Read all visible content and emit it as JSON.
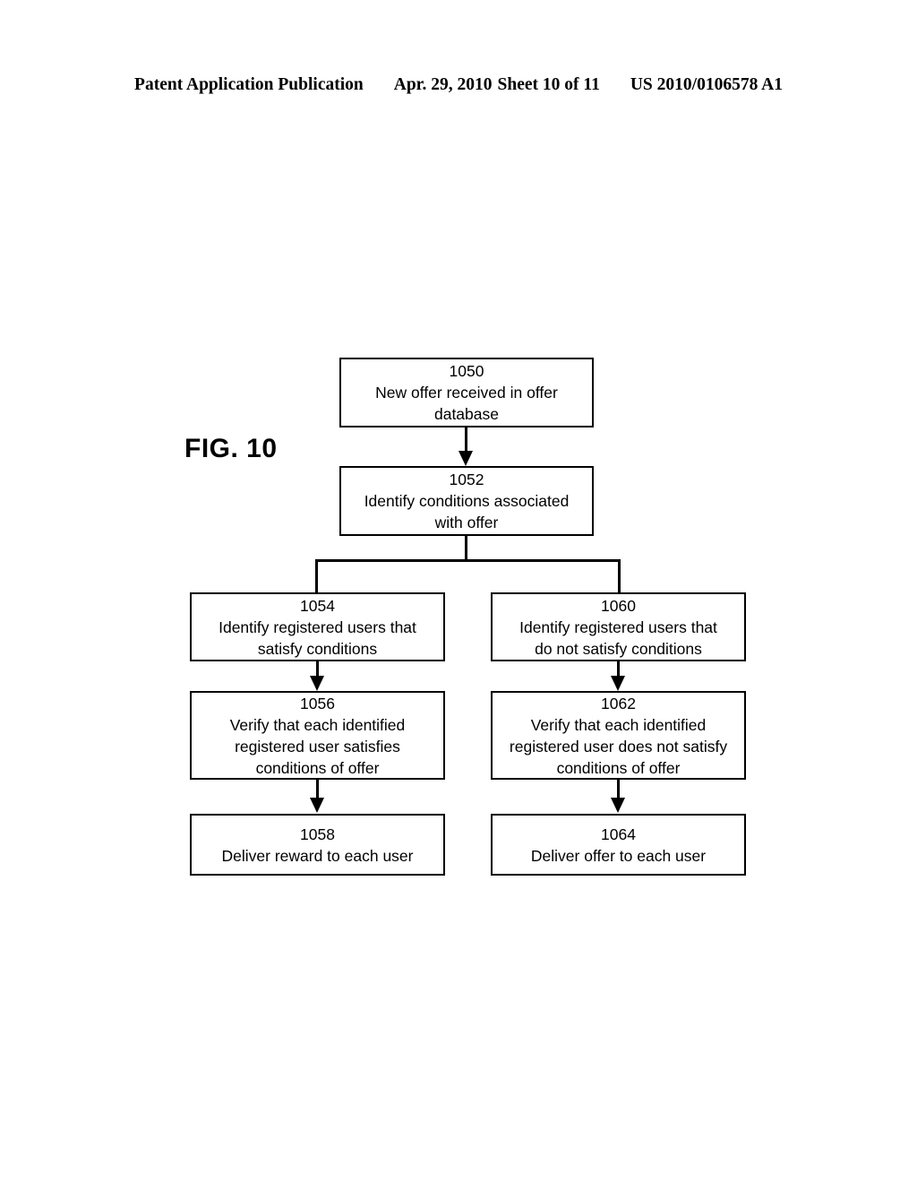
{
  "header": {
    "publication": "Patent Application Publication",
    "date": "Apr. 29, 2010",
    "sheet": "Sheet 10 of 11",
    "patent_number": "US 2010/0106578 A1"
  },
  "figure": {
    "label": "FIG. 10"
  },
  "flowchart": {
    "boxes": [
      {
        "id": "1050",
        "number": "1050",
        "text": "New offer received in offer\ndatabase"
      },
      {
        "id": "1052",
        "number": "1052",
        "text": "Identify conditions associated\nwith offer"
      },
      {
        "id": "1054",
        "number": "1054",
        "text": "Identify registered users that\nsatisfy conditions"
      },
      {
        "id": "1056",
        "number": "1056",
        "text": "Verify that each identified\nregistered user satisfies\nconditions of offer"
      },
      {
        "id": "1058",
        "number": "1058",
        "text": "Deliver reward to each user"
      },
      {
        "id": "1060",
        "number": "1060",
        "text": "Identify registered users that\ndo not satisfy conditions"
      },
      {
        "id": "1062",
        "number": "1062",
        "text": "Verify that each identified\nregistered user does not satisfy\nconditions of offer"
      },
      {
        "id": "1064",
        "number": "1064",
        "text": "Deliver offer to each user"
      }
    ],
    "connectors": [
      {
        "from": "1050",
        "to": "1052",
        "arrow": true
      },
      {
        "from": "1052",
        "to": "1054",
        "arrow": false
      },
      {
        "from": "1052",
        "to": "1060",
        "arrow": false
      },
      {
        "from": "1054",
        "to": "1056",
        "arrow": true
      },
      {
        "from": "1056",
        "to": "1058",
        "arrow": true
      },
      {
        "from": "1060",
        "to": "1062",
        "arrow": true
      },
      {
        "from": "1062",
        "to": "1064",
        "arrow": true
      }
    ]
  },
  "colors": {
    "ink": "#000000",
    "page": "#ffffff"
  }
}
